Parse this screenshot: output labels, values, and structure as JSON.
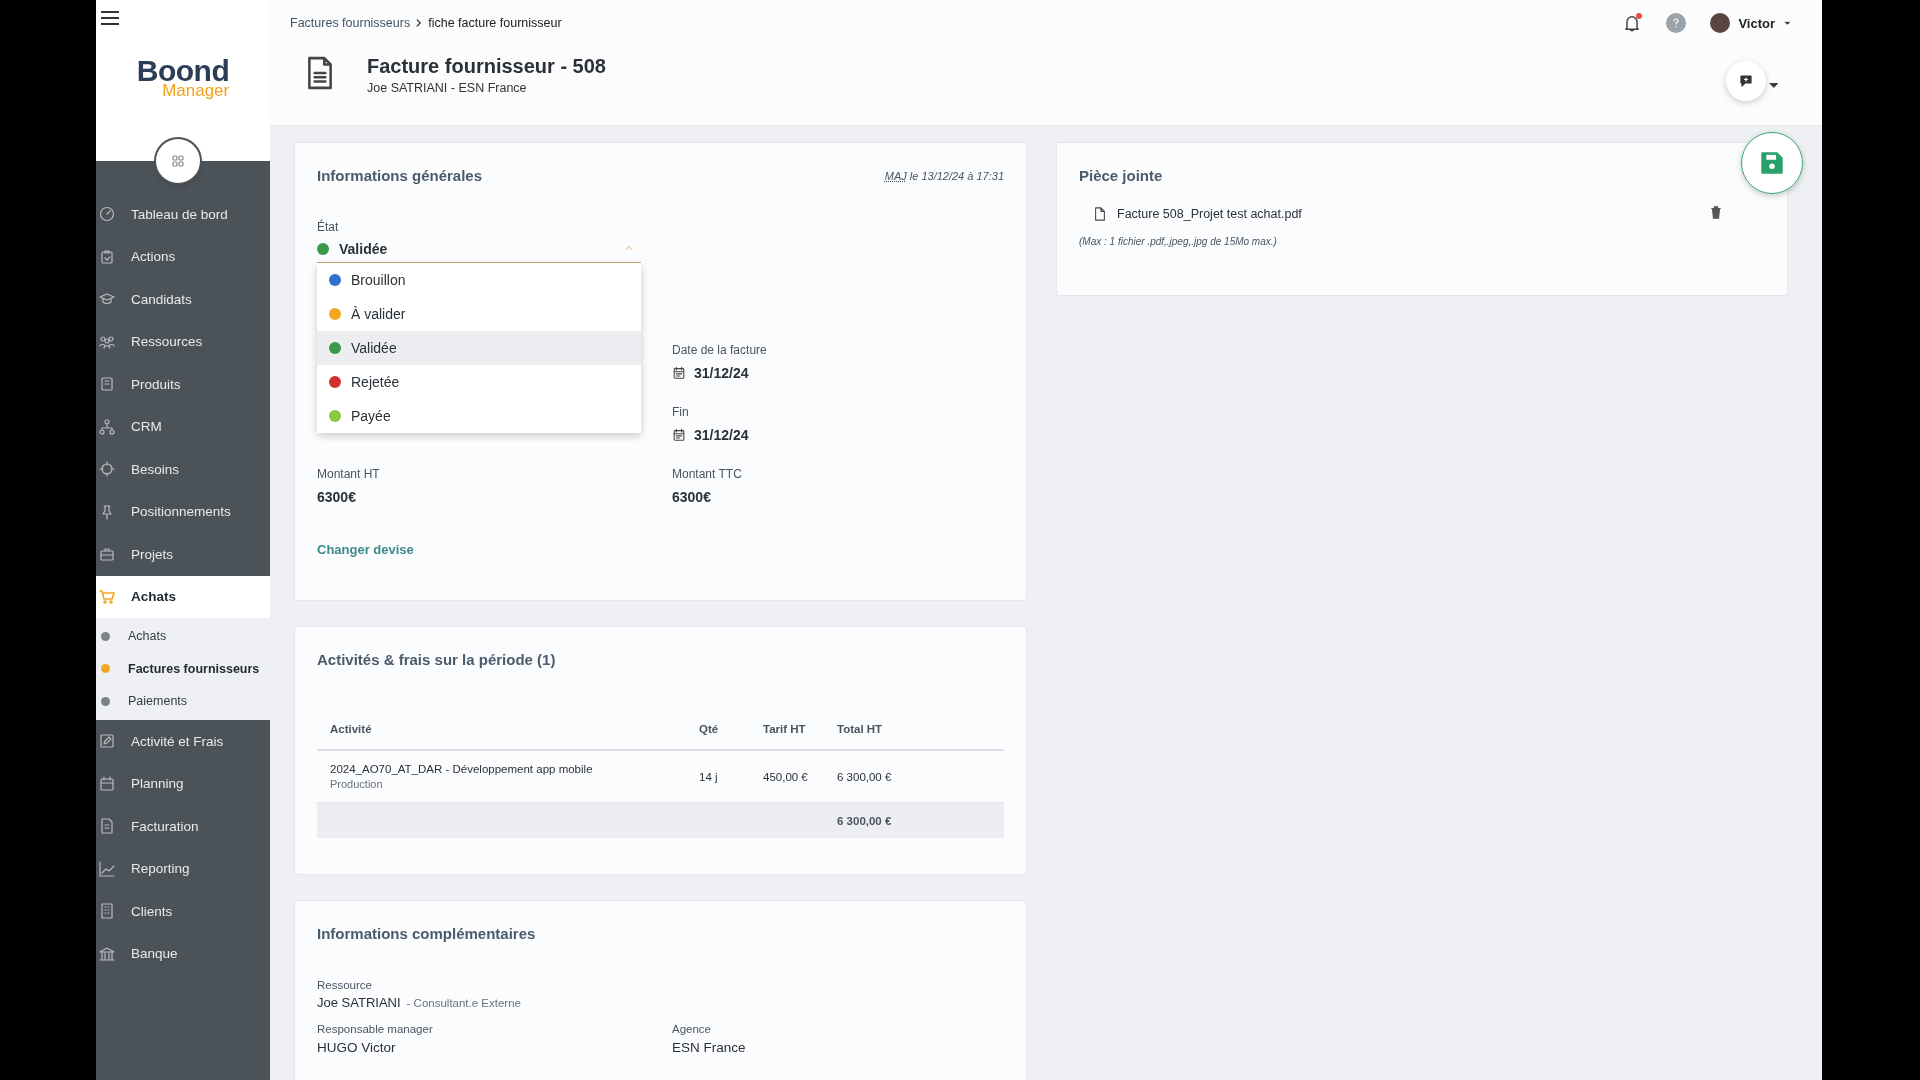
{
  "sidebar": {
    "logo": {
      "word": "Boond",
      "sub": "Manager"
    },
    "items": [
      {
        "label": "Tableau de bord",
        "selected": false
      },
      {
        "label": "Actions",
        "selected": false
      },
      {
        "label": "Candidats",
        "selected": false
      },
      {
        "label": "Ressources",
        "selected": false
      },
      {
        "label": "Produits",
        "selected": false
      },
      {
        "label": "CRM",
        "selected": false
      },
      {
        "label": "Besoins",
        "selected": false
      },
      {
        "label": "Positionnements",
        "selected": false
      },
      {
        "label": "Projets",
        "selected": false
      },
      {
        "label": "Achats",
        "selected": true,
        "expanded": true,
        "children": [
          {
            "label": "Achats",
            "selected": false
          },
          {
            "label": "Factures fournisseurs",
            "selected": true
          },
          {
            "label": "Paiements",
            "selected": false
          }
        ]
      },
      {
        "label": "Activité et Frais",
        "selected": false
      },
      {
        "label": "Planning",
        "selected": false
      },
      {
        "label": "Facturation",
        "selected": false
      },
      {
        "label": "Reporting",
        "selected": false
      },
      {
        "label": "Clients",
        "selected": false
      },
      {
        "label": "Banque",
        "selected": false
      }
    ]
  },
  "header": {
    "breadcrumb": [
      {
        "label": "Factures fournisseurs",
        "kind": "link"
      },
      {
        "label": "fiche facture fournisseur",
        "kind": "current"
      }
    ],
    "notifications": {
      "unread": true
    },
    "user": "Victor",
    "title": "Facture fournisseur - 508",
    "subtitle": "Joe SATRIANI - ESN France"
  },
  "general": {
    "title": "Informations générales",
    "updated_abbr": "MAJ",
    "updated": "le 13/12/24 à 17:31",
    "status": {
      "label": "État",
      "value": "Validée",
      "color": "#3a9a4a",
      "expanded": true,
      "options": [
        {
          "label": "Brouillon",
          "color": "#2f6fd0",
          "selected": false
        },
        {
          "label": "À valider",
          "color": "#f5a623",
          "selected": false
        },
        {
          "label": "Validée",
          "color": "#3a9a4a",
          "selected": true
        },
        {
          "label": "Rejetée",
          "color": "#d0302e",
          "selected": false
        },
        {
          "label": "Payée",
          "color": "#8cc63f",
          "selected": false
        }
      ]
    },
    "rows": [
      {
        "right": {
          "label": "Date de la facture",
          "value": "31/12/24",
          "kind": "date"
        }
      },
      {
        "right": {
          "label": "Fin",
          "value": "31/12/24",
          "kind": "date"
        }
      },
      {
        "left": {
          "label": "Montant HT",
          "value": "6300€",
          "kind": "text"
        },
        "right": {
          "label": "Montant TTC",
          "value": "6300€",
          "kind": "text"
        }
      }
    ],
    "link": "Changer devise"
  },
  "activities": {
    "title": "Activités & frais sur la période (1)",
    "columns": [
      "Activité",
      "Qté",
      "Tarif HT",
      "Total HT"
    ],
    "rows": [
      {
        "activity": "2024_AO70_AT_DAR - Développement app mobile",
        "type": "Production",
        "qty": "14 j",
        "rate": "450,00 €",
        "total": "6 300,00 €"
      }
    ],
    "total": "6 300,00 €"
  },
  "attachment": {
    "title": "Pièce jointe",
    "file": "Facture 508_Projet test achat.pdf",
    "note": "(Max : 1 fichier .pdf,.jpeg,.jpg de 15Mo max.)"
  },
  "extra": {
    "title": "Informations complémentaires",
    "resource": {
      "label": "Ressource",
      "name": "Joe SATRIANI",
      "role": "- Consultant.e Externe"
    },
    "fields": [
      {
        "label": "Responsable manager",
        "value": "HUGO Victor"
      },
      {
        "label": "Agence",
        "value": "ESN France"
      }
    ]
  }
}
